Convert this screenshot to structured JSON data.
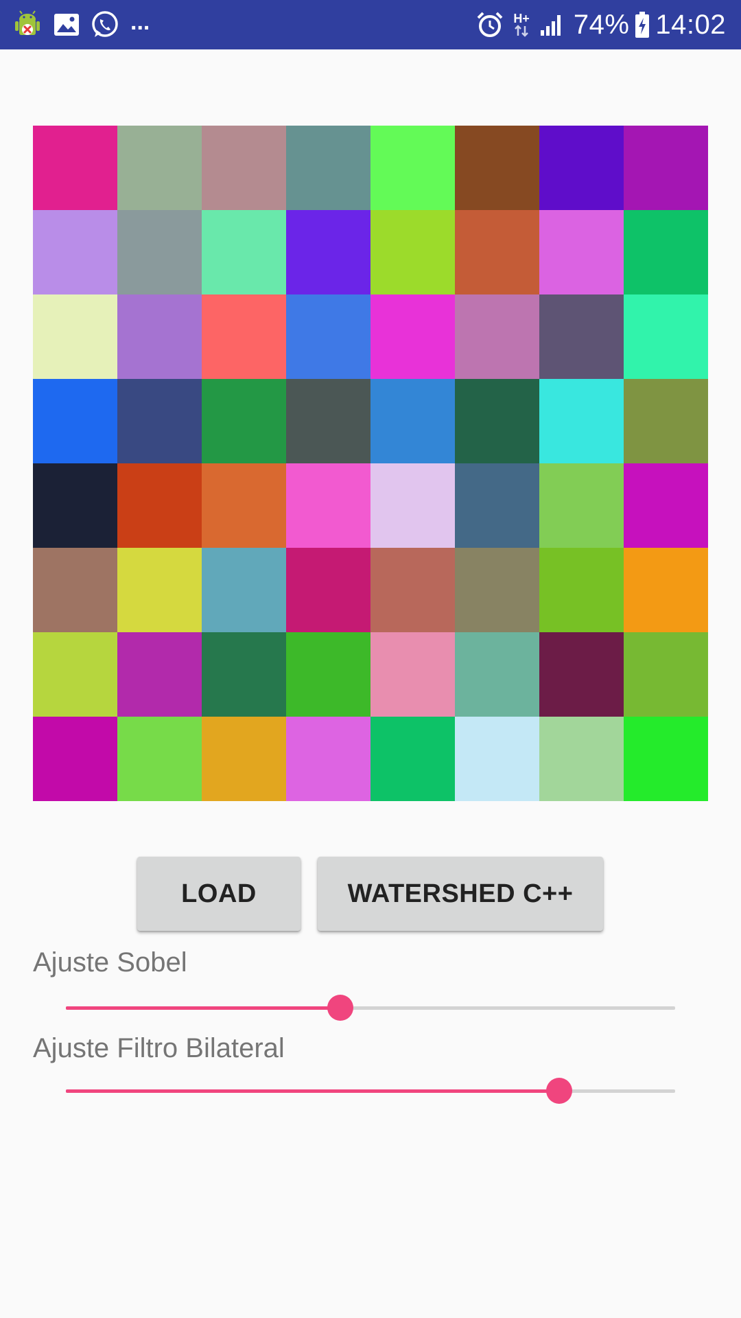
{
  "status_bar": {
    "icons_left": [
      "android-debug-icon",
      "image-icon",
      "whatsapp-icon"
    ],
    "overflow": "...",
    "icons_right": [
      "alarm-icon",
      "network-icon",
      "signal-icon",
      "battery-icon"
    ],
    "network_type": "H+",
    "battery": "74%",
    "time": "14:02",
    "color": "#303f9f"
  },
  "image": {
    "rows": 8,
    "cols": 8,
    "tiles": [
      "#e1208f",
      "#98b095",
      "#b48b90",
      "#669291",
      "#63fa57",
      "#864922",
      "#5f0dca",
      "#a416b3",
      "#b98de8",
      "#8a9a9c",
      "#69e8ab",
      "#6b25e8",
      "#9cdb2b",
      "#c45c37",
      "#db63e2",
      "#0ec268",
      "#e6f1b9",
      "#a573d1",
      "#fd6565",
      "#3f79e6",
      "#e832d8",
      "#bd75b0",
      "#5e5474",
      "#31f3ab",
      "#1e69f0",
      "#394982",
      "#239845",
      "#4b5755",
      "#3386d6",
      "#236348",
      "#39e7df",
      "#7f9442",
      "#1b2136",
      "#ca3f16",
      "#d96930",
      "#f25ad0",
      "#e1c5ee",
      "#446987",
      "#82cd55",
      "#c611bd",
      "#9e7463",
      "#d5d93f",
      "#61a8ba",
      "#c51a73",
      "#b8685b",
      "#888363",
      "#77c125",
      "#f39a14",
      "#b6d63e",
      "#b22aab",
      "#26784d",
      "#3db929",
      "#e88eaf",
      "#6cb39d",
      "#6c1c47",
      "#77b933",
      "#c20aa9",
      "#77db49",
      "#e2a61f",
      "#dd64e2",
      "#0dc267",
      "#c4e8f6",
      "#a2d69a",
      "#24eb2b"
    ]
  },
  "buttons": {
    "load": "LOAD",
    "watershed": "WATERSHED C++"
  },
  "sobel": {
    "label": "Ajuste Sobel",
    "value_fraction": 0.45
  },
  "bilateral": {
    "label": "Ajuste Filtro Bilateral",
    "value_fraction": 0.81
  },
  "accent_color": "#f0457e"
}
